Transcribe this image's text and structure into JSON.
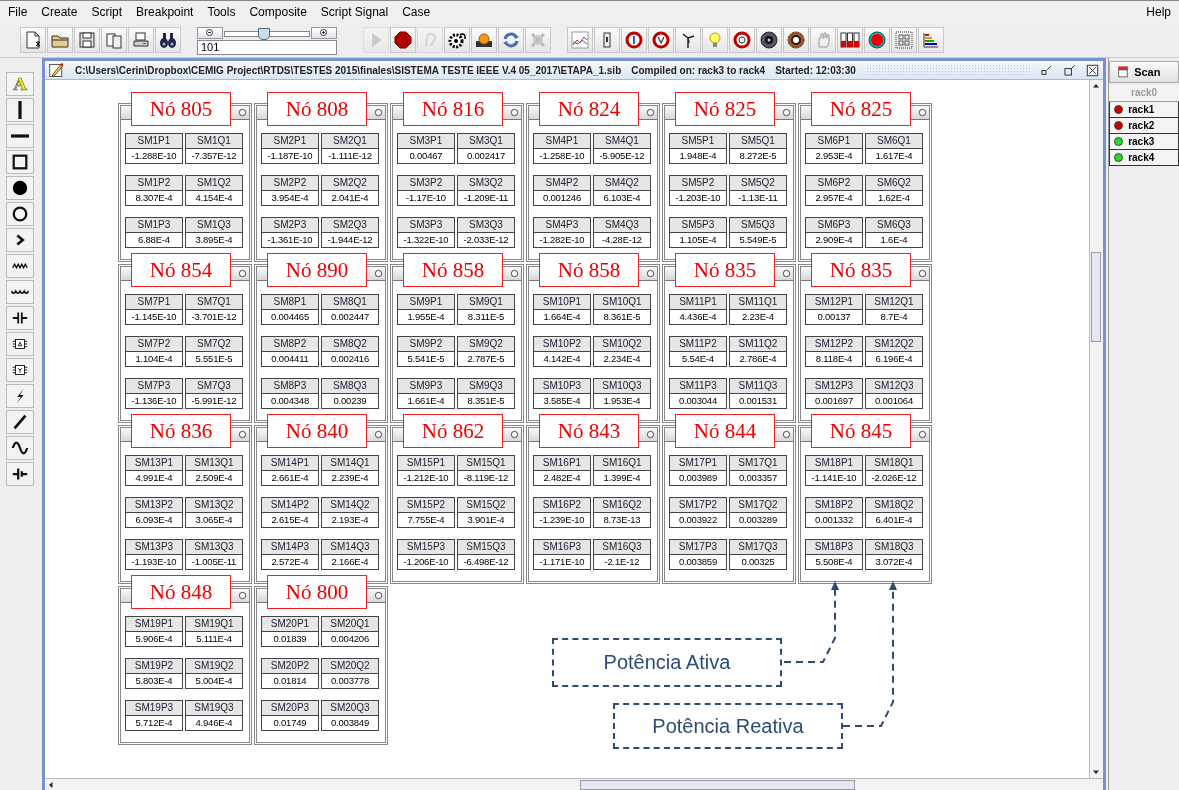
{
  "menu": [
    "File",
    "Create",
    "Script",
    "Breakpoint",
    "Tools",
    "Composite",
    "Script Signal",
    "Case"
  ],
  "help": "Help",
  "toolbar": {
    "zoom": {
      "value": "101",
      "level": 0.45
    },
    "play_disabled": true,
    "ear_disabled": true
  },
  "palette": {
    "text_tool": "A"
  },
  "window": {
    "path": "C:\\Users\\Cerin\\Dropbox\\CEMIG Project\\RTDS\\TESTES 2015\\finales\\SISTEMA TESTE IEEE V.4 05_2017\\ETAPA_1.sib",
    "compiled": "Compiled on: rack3 to rack4",
    "started": "Started: 12:03:30"
  },
  "panels": [
    {
      "label": "Nó 805",
      "meters": [
        [
          "SM1P1",
          "-1.288E-10"
        ],
        [
          "SM1Q1",
          "-7.357E-12"
        ],
        [
          "SM1P2",
          "8.307E-4"
        ],
        [
          "SM1Q2",
          "4.154E-4"
        ],
        [
          "SM1P3",
          "6.88E-4"
        ],
        [
          "SM1Q3",
          "3.895E-4"
        ]
      ]
    },
    {
      "label": "Nó 808",
      "meters": [
        [
          "SM2P1",
          "-1.187E-10"
        ],
        [
          "SM2Q1",
          "-1.111E-12"
        ],
        [
          "SM2P2",
          "3.954E-4"
        ],
        [
          "SM2Q2",
          "2.041E-4"
        ],
        [
          "SM2P3",
          "-1.361E-10"
        ],
        [
          "SM2Q3",
          "-1.944E-12"
        ]
      ]
    },
    {
      "label": "Nó 816",
      "meters": [
        [
          "SM3P1",
          "0.00467"
        ],
        [
          "SM3Q1",
          "0.002417"
        ],
        [
          "SM3P2",
          "-1.17E-10"
        ],
        [
          "SM3Q2",
          "-1.209E-11"
        ],
        [
          "SM3P3",
          "-1.322E-10"
        ],
        [
          "SM3Q3",
          "-2.033E-12"
        ]
      ]
    },
    {
      "label": "Nó 824",
      "meters": [
        [
          "SM4P1",
          "-1.258E-10"
        ],
        [
          "SM4Q1",
          "-5.905E-12"
        ],
        [
          "SM4P2",
          "0.001246"
        ],
        [
          "SM4Q2",
          "6.103E-4"
        ],
        [
          "SM4P3",
          "-1.282E-10"
        ],
        [
          "SM4Q3",
          "-4.28E-12"
        ]
      ]
    },
    {
      "label": "Nó 825",
      "meters": [
        [
          "SM5P1",
          "1.948E-4"
        ],
        [
          "SM5Q1",
          "8.272E-5"
        ],
        [
          "SM5P2",
          "-1.203E-10"
        ],
        [
          "SM5Q2",
          "-1.13E-11"
        ],
        [
          "SM5P3",
          "1.105E-4"
        ],
        [
          "SM5Q3",
          "5.549E-5"
        ]
      ]
    },
    {
      "label": "Nó 825",
      "meters": [
        [
          "SM6P1",
          "2.953E-4"
        ],
        [
          "SM6Q1",
          "1.617E-4"
        ],
        [
          "SM6P2",
          "2.957E-4"
        ],
        [
          "SM6Q2",
          "1.62E-4"
        ],
        [
          "SM6P3",
          "2.909E-4"
        ],
        [
          "SM6Q3",
          "1.6E-4"
        ]
      ]
    },
    {
      "label": "Nó 854",
      "meters": [
        [
          "SM7P1",
          "-1.145E-10"
        ],
        [
          "SM7Q1",
          "-3.701E-12"
        ],
        [
          "SM7P2",
          "1.104E-4"
        ],
        [
          "SM7Q2",
          "5.551E-5"
        ],
        [
          "SM7P3",
          "-1.136E-10"
        ],
        [
          "SM7Q3",
          "-5.991E-12"
        ]
      ]
    },
    {
      "label": "Nó 890",
      "meters": [
        [
          "SM8P1",
          "0.004465"
        ],
        [
          "SM8Q1",
          "0.002447"
        ],
        [
          "SM8P2",
          "0.004411"
        ],
        [
          "SM8Q2",
          "0.002416"
        ],
        [
          "SM8P3",
          "0.004348"
        ],
        [
          "SM8Q3",
          "0.00239"
        ]
      ]
    },
    {
      "label": "Nó 858",
      "meters": [
        [
          "SM9P1",
          "1.955E-4"
        ],
        [
          "SM9Q1",
          "8.311E-5"
        ],
        [
          "SM9P2",
          "5.541E-5"
        ],
        [
          "SM9Q2",
          "2.787E-5"
        ],
        [
          "SM9P3",
          "1.661E-4"
        ],
        [
          "SM9Q3",
          "8.351E-5"
        ]
      ]
    },
    {
      "label": "Nó 858",
      "meters": [
        [
          "SM10P1",
          "1.664E-4"
        ],
        [
          "SM10Q1",
          "8.361E-5"
        ],
        [
          "SM10P2",
          "4.142E-4"
        ],
        [
          "SM10Q2",
          "2.234E-4"
        ],
        [
          "SM10P3",
          "3.585E-4"
        ],
        [
          "SM10Q3",
          "1.953E-4"
        ]
      ]
    },
    {
      "label": "Nó 835",
      "meters": [
        [
          "SM11P1",
          "4.436E-4"
        ],
        [
          "SM11Q1",
          "2.23E-4"
        ],
        [
          "SM11P2",
          "5.54E-4"
        ],
        [
          "SM11Q2",
          "2.786E-4"
        ],
        [
          "SM11P3",
          "0.003044"
        ],
        [
          "SM11Q3",
          "0.001531"
        ]
      ]
    },
    {
      "label": "Nó 835",
      "meters": [
        [
          "SM12P1",
          "0.00137"
        ],
        [
          "SM12Q1",
          "8.7E-4"
        ],
        [
          "SM12P2",
          "8.118E-4"
        ],
        [
          "SM12Q2",
          "6.196E-4"
        ],
        [
          "SM12P3",
          "0.001697"
        ],
        [
          "SM12Q3",
          "0.001064"
        ]
      ]
    },
    {
      "label": "Nó 836",
      "meters": [
        [
          "SM13P1",
          "4.991E-4"
        ],
        [
          "SM13Q1",
          "2.509E-4"
        ],
        [
          "SM13P2",
          "6.093E-4"
        ],
        [
          "SM13Q2",
          "3.065E-4"
        ],
        [
          "SM13P3",
          "-1.193E-10"
        ],
        [
          "SM13Q3",
          "-1.005E-11"
        ]
      ]
    },
    {
      "label": "Nó 840",
      "meters": [
        [
          "SM14P1",
          "2.661E-4"
        ],
        [
          "SM14Q1",
          "2.239E-4"
        ],
        [
          "SM14P2",
          "2.615E-4"
        ],
        [
          "SM14Q2",
          "2.193E-4"
        ],
        [
          "SM14P3",
          "2.572E-4"
        ],
        [
          "SM14Q3",
          "2.166E-4"
        ]
      ]
    },
    {
      "label": "Nó 862",
      "meters": [
        [
          "SM15P1",
          "-1.212E-10"
        ],
        [
          "SM15Q1",
          "-8.119E-12"
        ],
        [
          "SM15P2",
          "7.755E-4"
        ],
        [
          "SM15Q2",
          "3.901E-4"
        ],
        [
          "SM15P3",
          "-1.206E-10"
        ],
        [
          "SM15Q3",
          "-6.498E-12"
        ]
      ]
    },
    {
      "label": "Nó 843",
      "meters": [
        [
          "SM16P1",
          "2.482E-4"
        ],
        [
          "SM16Q1",
          "1.399E-4"
        ],
        [
          "SM16P2",
          "-1.239E-10"
        ],
        [
          "SM16Q2",
          "8.73E-13"
        ],
        [
          "SM16P3",
          "-1.171E-10"
        ],
        [
          "SM16Q3",
          "-2.1E-12"
        ]
      ]
    },
    {
      "label": "Nó 844",
      "meters": [
        [
          "SM17P1",
          "0.003989"
        ],
        [
          "SM17Q1",
          "0.003357"
        ],
        [
          "SM17P2",
          "0.003922"
        ],
        [
          "SM17Q2",
          "0.003289"
        ],
        [
          "SM17P3",
          "0.003859"
        ],
        [
          "SM17Q3",
          "0.00325"
        ]
      ]
    },
    {
      "label": "Nó 845",
      "meters": [
        [
          "SM18P1",
          "-1.141E-10"
        ],
        [
          "SM18Q1",
          "-2.026E-12"
        ],
        [
          "SM18P2",
          "0.001332"
        ],
        [
          "SM18Q2",
          "6.401E-4"
        ],
        [
          "SM18P3",
          "5.508E-4"
        ],
        [
          "SM18Q3",
          "3.072E-4"
        ]
      ]
    },
    {
      "label": "Nó 848",
      "meters": [
        [
          "SM19P1",
          "5.906E-4"
        ],
        [
          "SM19Q1",
          "5.111E-4"
        ],
        [
          "SM19P2",
          "5.803E-4"
        ],
        [
          "SM19Q2",
          "5.004E-4"
        ],
        [
          "SM19P3",
          "5.712E-4"
        ],
        [
          "SM19Q3",
          "4.946E-4"
        ]
      ]
    },
    {
      "label": "Nó 800",
      "meters": [
        [
          "SM20P1",
          "0.01839"
        ],
        [
          "SM20Q1",
          "0.004206"
        ],
        [
          "SM20P2",
          "0.01814"
        ],
        [
          "SM20Q2",
          "0.003778"
        ],
        [
          "SM20P3",
          "0.01749"
        ],
        [
          "SM20Q3",
          "0.003849"
        ]
      ]
    }
  ],
  "callouts": [
    {
      "text": "Potência Ativa"
    },
    {
      "text": "Potência Reativa"
    }
  ],
  "rack_panel": {
    "scan": "Scan",
    "header": "rack0",
    "racks": [
      {
        "label": "rack1",
        "color": "#cc0000"
      },
      {
        "label": "rack2",
        "color": "#cc0000"
      },
      {
        "label": "rack3",
        "color": "#22dd22"
      },
      {
        "label": "rack4",
        "color": "#22dd22"
      }
    ]
  }
}
